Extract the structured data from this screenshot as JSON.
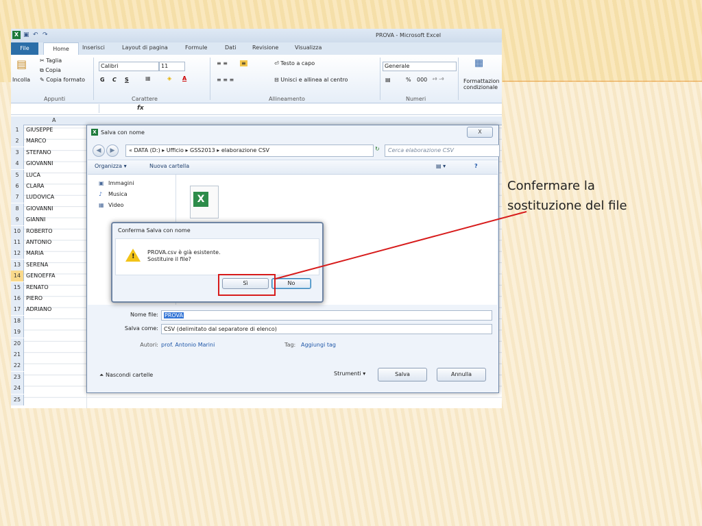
{
  "window": {
    "title": "PROVA - Microsoft Excel"
  },
  "ribbon": {
    "tabs": [
      "File",
      "Home",
      "Inserisci",
      "Layout di pagina",
      "Formule",
      "Dati",
      "Revisione",
      "Visualizza"
    ],
    "clipboard": {
      "paste": "Incolla",
      "cut": "Taglia",
      "copy": "Copia",
      "format_painter": "Copia formato",
      "group": "Appunti"
    },
    "font": {
      "name": "Calibri",
      "size": "11",
      "bold": "G",
      "italic": "C",
      "underline": "S",
      "group": "Carattere"
    },
    "alignment": {
      "wrap": "Testo a capo",
      "merge": "Unisci e allinea al centro",
      "group": "Allineamento"
    },
    "number": {
      "format": "Generale",
      "percent": "%",
      "thousands": "000",
      "group": "Numeri"
    },
    "styles": {
      "conditional_line1": "Formattazion",
      "conditional_line2": "condizionale"
    }
  },
  "formula_bar": {
    "fx": "fx"
  },
  "sheet": {
    "column_a": "A",
    "rows": [
      {
        "n": "1",
        "v": "GIUSEPPE"
      },
      {
        "n": "2",
        "v": "MARCO"
      },
      {
        "n": "3",
        "v": "STEFANO"
      },
      {
        "n": "4",
        "v": "GIOVANNI"
      },
      {
        "n": "5",
        "v": "LUCA"
      },
      {
        "n": "6",
        "v": "CLARA"
      },
      {
        "n": "7",
        "v": "LUDOVICA"
      },
      {
        "n": "8",
        "v": "GIOVANNI"
      },
      {
        "n": "9",
        "v": "GIANNI"
      },
      {
        "n": "10",
        "v": "ROBERTO"
      },
      {
        "n": "11",
        "v": "ANTONIO"
      },
      {
        "n": "12",
        "v": "MARIA"
      },
      {
        "n": "13",
        "v": "SERENA"
      },
      {
        "n": "14",
        "v": "GENOEFFA"
      },
      {
        "n": "15",
        "v": "RENATO"
      },
      {
        "n": "16",
        "v": "PIERO"
      },
      {
        "n": "17",
        "v": "ADRIANO"
      },
      {
        "n": "18",
        "v": ""
      },
      {
        "n": "19",
        "v": ""
      },
      {
        "n": "20",
        "v": ""
      },
      {
        "n": "21",
        "v": ""
      },
      {
        "n": "22",
        "v": ""
      },
      {
        "n": "23",
        "v": ""
      },
      {
        "n": "24",
        "v": ""
      },
      {
        "n": "25",
        "v": ""
      }
    ]
  },
  "save_dialog": {
    "title": "Salva con nome",
    "close": "X",
    "address": "« DATA (D:) ▸ Ufficio ▸ GSS2013 ▸ elaborazione CSV",
    "search_placeholder": "Cerca elaborazione CSV",
    "organize": "Organizza ▾",
    "new_folder": "Nuova cartella",
    "nav_items": [
      "Immagini",
      "Musica",
      "Video"
    ],
    "filename_label": "Nome file:",
    "filename_value": "PROVA",
    "saveas_label": "Salva come:",
    "saveas_value": "CSV (delimitato dal separatore di elenco)",
    "authors_label": "Autori:",
    "authors_value": "prof. Antonio Marini",
    "tags_label": "Tag:",
    "tags_value": "Aggiungi tag",
    "hide_folders": "Nascondi cartelle",
    "tools": "Strumenti",
    "save": "Salva",
    "cancel": "Annulla"
  },
  "confirm_dialog": {
    "title": "Conferma Salva con nome",
    "message_line1": "PROVA.csv è già esistente.",
    "message_line2": "Sostituire il file?",
    "yes": "Sì",
    "no": "No"
  },
  "callout": {
    "line1": "Confermare la",
    "line2": "sostituzione del file"
  },
  "colors": {
    "highlight": "#d71b1b",
    "excel_green": "#1d7a3a",
    "accent_line": "#e8a04d"
  }
}
